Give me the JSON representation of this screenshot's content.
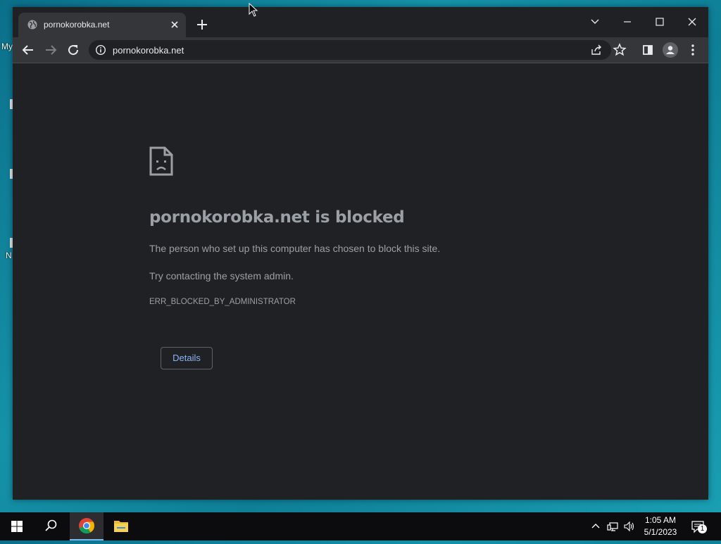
{
  "desktop": {
    "icon_labels": [
      "My",
      "N"
    ]
  },
  "browser": {
    "tab": {
      "title": "pornokorobka.net"
    },
    "address_bar": {
      "url": "pornokorobka.net"
    }
  },
  "error_page": {
    "title": "pornokorobka.net is blocked",
    "message": "The person who set up this computer has chosen to block this site.",
    "suggestion": "Try contacting the system admin.",
    "error_code": "ERR_BLOCKED_BY_ADMINISTRATOR",
    "details_button": "Details"
  },
  "taskbar": {
    "clock_time": "1:05 AM",
    "clock_date": "5/1/2023",
    "notification_count": "1"
  },
  "colors": {
    "browser_bg": "#202124",
    "toolbar_bg": "#35363a",
    "link_blue": "#8ab4f8",
    "text_gray": "#9aa0a6"
  }
}
